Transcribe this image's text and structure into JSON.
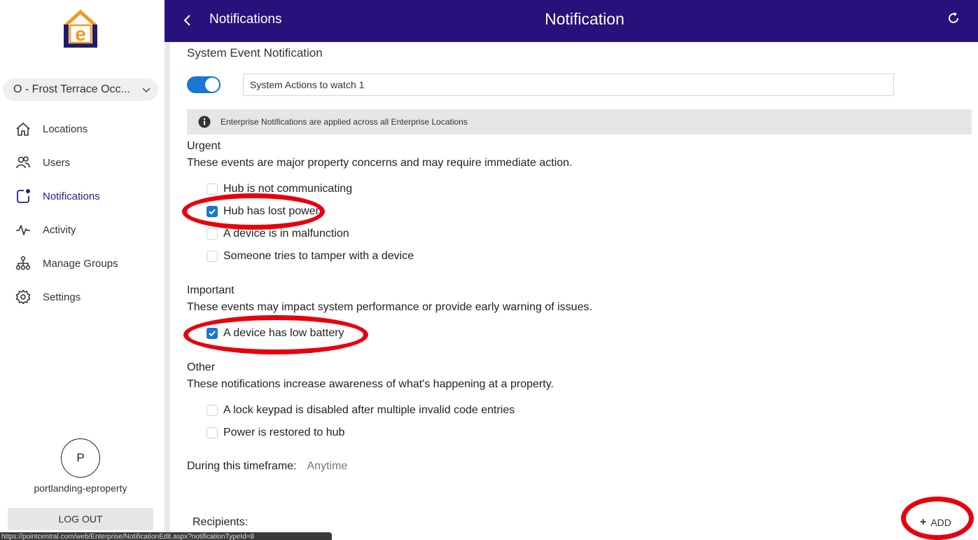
{
  "sidebar": {
    "location_select": "O - Frost Terrace Occ...",
    "nav": [
      {
        "label": "Locations",
        "icon": "home-icon"
      },
      {
        "label": "Users",
        "icon": "users-icon"
      },
      {
        "label": "Notifications",
        "icon": "notification-icon",
        "active": true
      },
      {
        "label": "Activity",
        "icon": "activity-icon"
      },
      {
        "label": "Manage Groups",
        "icon": "groups-icon"
      },
      {
        "label": "Settings",
        "icon": "gear-icon"
      }
    ],
    "avatar_initial": "P",
    "username": "portlanding-eproperty",
    "logout_label": "LOG OUT"
  },
  "header": {
    "back_label": "Notifications",
    "title": "Notification"
  },
  "main": {
    "section_title": "System Event Notification",
    "toggle_on": true,
    "name_value": "System Actions to watch 1",
    "info_text": "Enterprise Notifications are applied across all Enterprise Locations",
    "groups": {
      "urgent": {
        "label": "Urgent",
        "description": "These events are major property concerns and may require immediate action.",
        "items": [
          {
            "label": "Hub is not communicating",
            "checked": false
          },
          {
            "label": "Hub has lost power",
            "checked": true
          },
          {
            "label": "A device is in malfunction",
            "checked": false
          },
          {
            "label": "Someone tries to tamper with a device",
            "checked": false
          }
        ]
      },
      "important": {
        "label": "Important",
        "description": "These events may impact system performance or provide early warning of issues.",
        "items": [
          {
            "label": "A device has low battery",
            "checked": true
          }
        ]
      },
      "other": {
        "label": "Other",
        "description": "These notifications increase awareness of what's happening at a property.",
        "items": [
          {
            "label": "A lock keypad is disabled after multiple invalid code entries",
            "checked": false
          },
          {
            "label": "Power is restored to hub",
            "checked": false
          }
        ]
      }
    },
    "timeframe_label": "During this timeframe:",
    "timeframe_value": "Anytime",
    "recipients_label": "Recipients:",
    "add_label": "ADD"
  },
  "status_bar_url": "https://pointcentral.com/web/Enterprise/NotificationEdit.aspx?notificationTypeId=8",
  "colors": {
    "header_bg": "#26127a",
    "accent": "#1976d2",
    "annotation": "#e8000d",
    "logo_orange": "#f39a1e",
    "logo_navy": "#1f1d6b"
  }
}
